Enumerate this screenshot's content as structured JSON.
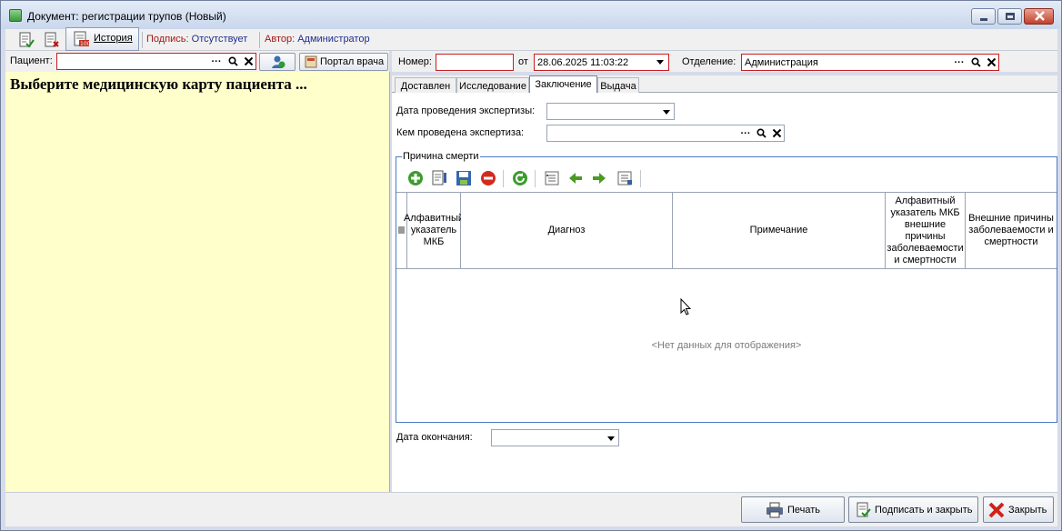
{
  "window": {
    "title": "Документ: регистрации трупов (Новый)"
  },
  "toolbar": {
    "history_label": "История",
    "signature_label": "Подпись:",
    "signature_value": "Отсутствует",
    "author_label": "Автор:",
    "author_value": "Администратор"
  },
  "patient": {
    "label": "Пациент:",
    "value": "",
    "portal_button": "Портал врача",
    "placeholder_message": "Выберите медицинскую карту пациента ..."
  },
  "header_fields": {
    "number_label": "Номер:",
    "number_value": "",
    "date_label": "от",
    "date_value": "28.06.2025 11:03:22",
    "department_label": "Отделение:",
    "department_value": "Администрация"
  },
  "tabs": [
    {
      "label": "Доставлен"
    },
    {
      "label": "Исследование"
    },
    {
      "label": "Заключение"
    },
    {
      "label": "Выдача"
    }
  ],
  "active_tab": "Заключение",
  "conclusion": {
    "exam_date_label": "Дата проведения экспертизы:",
    "exam_date_value": "",
    "exam_by_label": "Кем проведена экспертиза:",
    "exam_by_value": "",
    "death_cause_group": "Причина смерти",
    "columns": [
      "Алфавитный указатель МКБ",
      "Диагноз",
      "Примечание",
      "Алфавитный указатель МКБ внешние причины заболеваемости и смертности",
      "Внешние причины заболеваемости и смертности"
    ],
    "empty_message": "<Нет данных для отображения>",
    "end_date_label": "Дата окончания:",
    "end_date_value": ""
  },
  "footer": {
    "print_button": "Печать",
    "sign_close_button": "Подписать и закрыть",
    "close_button": "Закрыть"
  },
  "colors": {
    "required_border": "#c81e1e",
    "left_panel_bg": "#ffffcc",
    "group_border": "#4a7bc0",
    "signature_label": "#a01818",
    "signature_value": "#1f2f8f"
  }
}
